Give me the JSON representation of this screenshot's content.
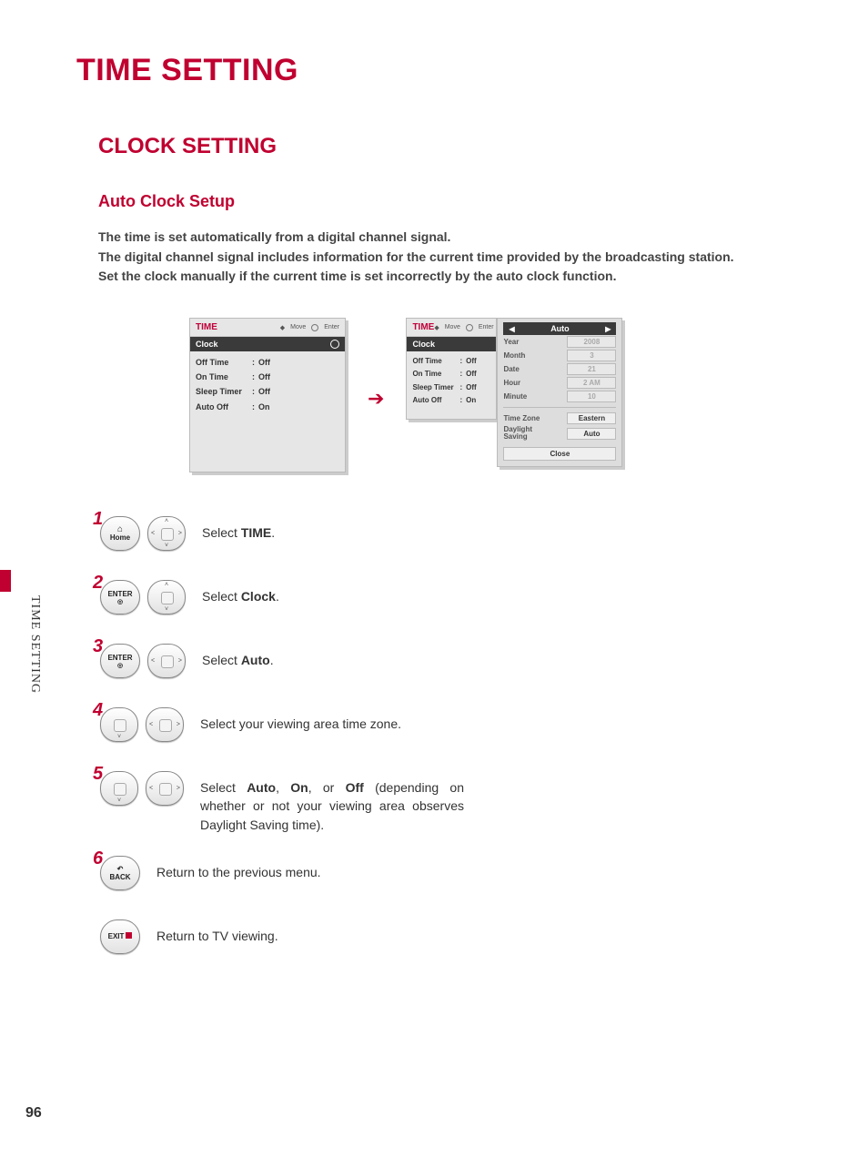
{
  "title": "TIME SETTING",
  "section": "CLOCK SETTING",
  "subsection": "Auto Clock Setup",
  "intro_lines": [
    "The time is set automatically from a digital channel signal.",
    "The digital channel signal includes information for the current time provided by the broadcasting station.",
    "Set the clock manually if the current time is set incorrectly by the auto clock function."
  ],
  "side_label": "TIME SETTING",
  "page_number": "96",
  "panel_a": {
    "title": "TIME",
    "hint_move": "Move",
    "hint_enter": "Enter",
    "selected": "Clock",
    "items": [
      {
        "label": "Off Time",
        "value": "Off"
      },
      {
        "label": "On Time",
        "value": "Off"
      },
      {
        "label": "Sleep Timer",
        "value": "Off"
      },
      {
        "label": "Auto Off",
        "value": "On"
      }
    ]
  },
  "panel_b_left": {
    "title": "TIME",
    "hint_move": "Move",
    "hint_enter": "Enter",
    "selected": "Clock",
    "items": [
      {
        "label": "Off Time",
        "value": "Off"
      },
      {
        "label": "On Time",
        "value": "Off"
      },
      {
        "label": "Sleep Timer",
        "value": "Off"
      },
      {
        "label": "Auto Off",
        "value": "On"
      }
    ]
  },
  "panel_b_right": {
    "mode": "Auto",
    "fields": [
      {
        "label": "Year",
        "value": "2008"
      },
      {
        "label": "Month",
        "value": "3"
      },
      {
        "label": "Date",
        "value": "21"
      },
      {
        "label": "Hour",
        "value": "2 AM"
      },
      {
        "label": "Minute",
        "value": "10"
      }
    ],
    "tz_label": "Time Zone",
    "tz_value": "Eastern",
    "ds_label": "Daylight Saving",
    "ds_value": "Auto",
    "close": "Close"
  },
  "buttons": {
    "home": "Home",
    "enter": "ENTER",
    "back": "BACK",
    "exit": "EXIT"
  },
  "steps": {
    "s1": {
      "pre": "Select ",
      "bold": "TIME",
      "post": "."
    },
    "s2": {
      "pre": "Select ",
      "bold": "Clock",
      "post": "."
    },
    "s3": {
      "pre": "Select ",
      "bold": "Auto",
      "post": "."
    },
    "s4": {
      "text": "Select your viewing area time zone."
    },
    "s5": {
      "pre": "Select ",
      "b1": "Auto",
      "m1": ", ",
      "b2": "On",
      "m2": ", or ",
      "b3": "Off",
      "post": " (depending on whether or not your viewing area observes Daylight Saving time)."
    },
    "s6": {
      "text": "Return to the previous menu."
    },
    "s7": {
      "text": "Return to TV viewing."
    }
  }
}
